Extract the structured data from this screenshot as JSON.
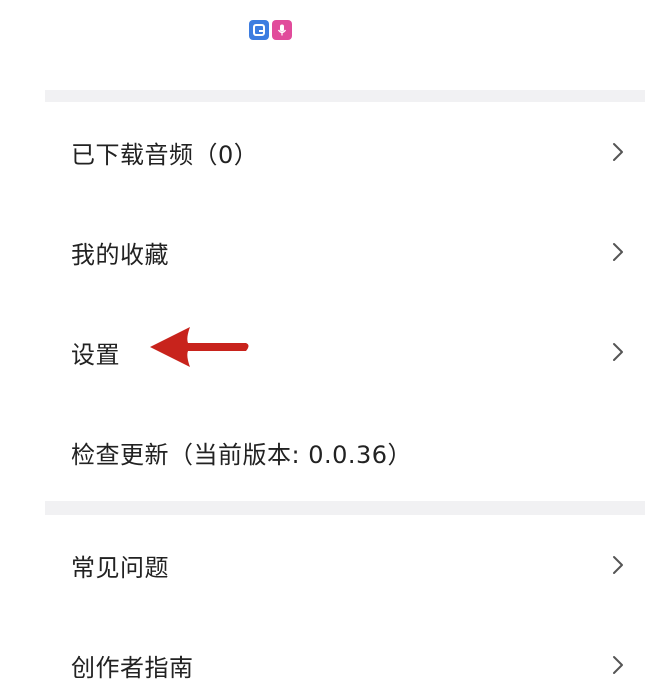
{
  "menu": {
    "items": [
      {
        "label": "已下载音频（0）",
        "has_chevron": true,
        "chevron_icon": "chevron-right-icon"
      },
      {
        "label": "我的收藏",
        "has_chevron": true,
        "chevron_icon": "chevron-right-icon"
      },
      {
        "label": "设置",
        "has_chevron": true,
        "chevron_icon": "chevron-right-icon"
      },
      {
        "label": "检查更新（当前版本: 0.0.36）",
        "has_chevron": false
      },
      {
        "label": "常见问题",
        "has_chevron": true,
        "chevron_icon": "chevron-right-icon"
      },
      {
        "label": "创作者指南",
        "has_chevron": true,
        "chevron_icon": "chevron-right-icon"
      }
    ]
  },
  "annotation": {
    "icon": "red-arrow-left-icon",
    "target": "设置",
    "color": "#c8231c"
  },
  "colors": {
    "background": "#ffffff",
    "divider": "#f1f1f3",
    "text": "#222222",
    "chevron": "#555555",
    "logo_blue": "#3d7de0",
    "logo_pink": "#e14b9b"
  },
  "icons": {
    "logo_left": "app-logo-icon",
    "logo_right": "microphone-logo-icon"
  }
}
